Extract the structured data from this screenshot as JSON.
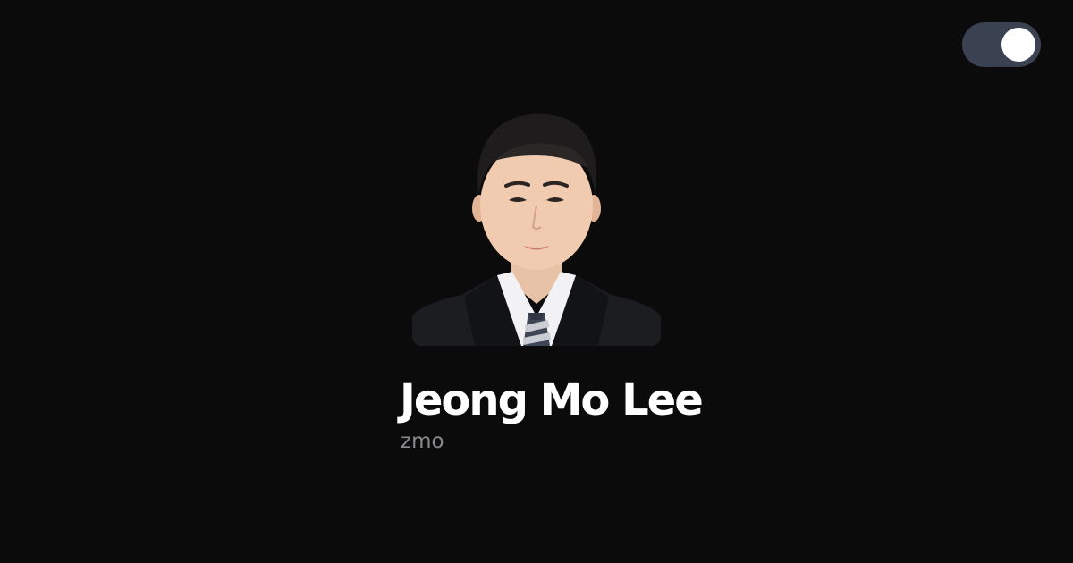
{
  "theme_toggle": {
    "icon": "toggle-switch-icon",
    "state": "on",
    "track_color": "#3a4150",
    "knob_color": "#ffffff"
  },
  "profile": {
    "photo_icon": "profile-photo",
    "name": "Jeong Mo Lee",
    "handle": "zmo"
  },
  "colors": {
    "background": "#0b0b0c",
    "name": "#ffffff",
    "handle": "#8a8a8e"
  }
}
